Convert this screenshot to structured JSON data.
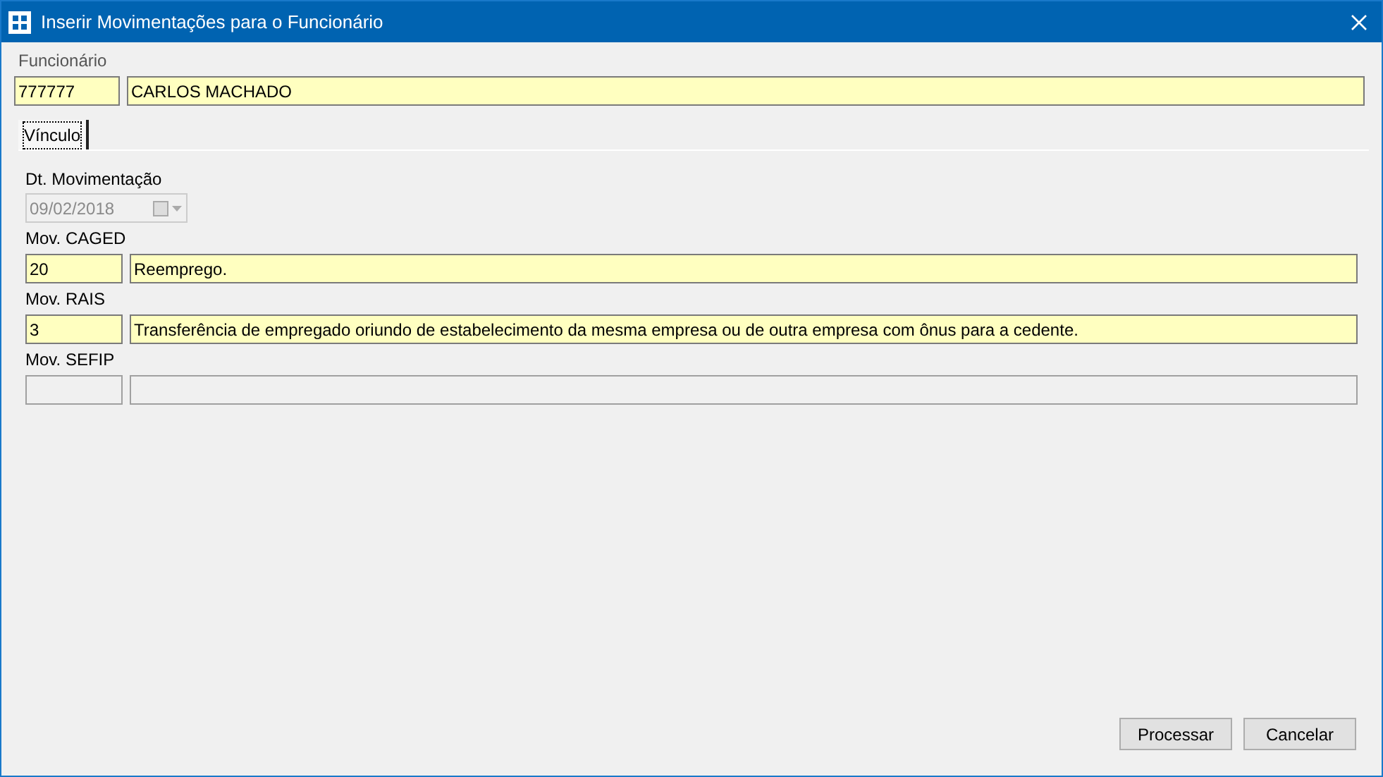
{
  "window": {
    "title": "Inserir Movimentações para o Funcionário"
  },
  "employee": {
    "label": "Funcionário",
    "code": "777777",
    "name": "CARLOS MACHADO"
  },
  "tabs": [
    {
      "label": "Vínculo",
      "selected": true
    }
  ],
  "date": {
    "label": "Dt. Movimentação",
    "value": "09/02/2018",
    "disabled": true
  },
  "movements": [
    {
      "label": "Mov. CAGED",
      "code": "20",
      "description": "Reemprego.",
      "disabled": false
    },
    {
      "label": "Mov. RAIS",
      "code": "3",
      "description": "Transferência de empregado oriundo de estabelecimento da mesma empresa ou de outra empresa com ônus para a cedente.",
      "disabled": false
    },
    {
      "label": "Mov. SEFIP",
      "disabled": true
    }
  ],
  "buttons": [
    "Processar",
    "Cancelar"
  ]
}
